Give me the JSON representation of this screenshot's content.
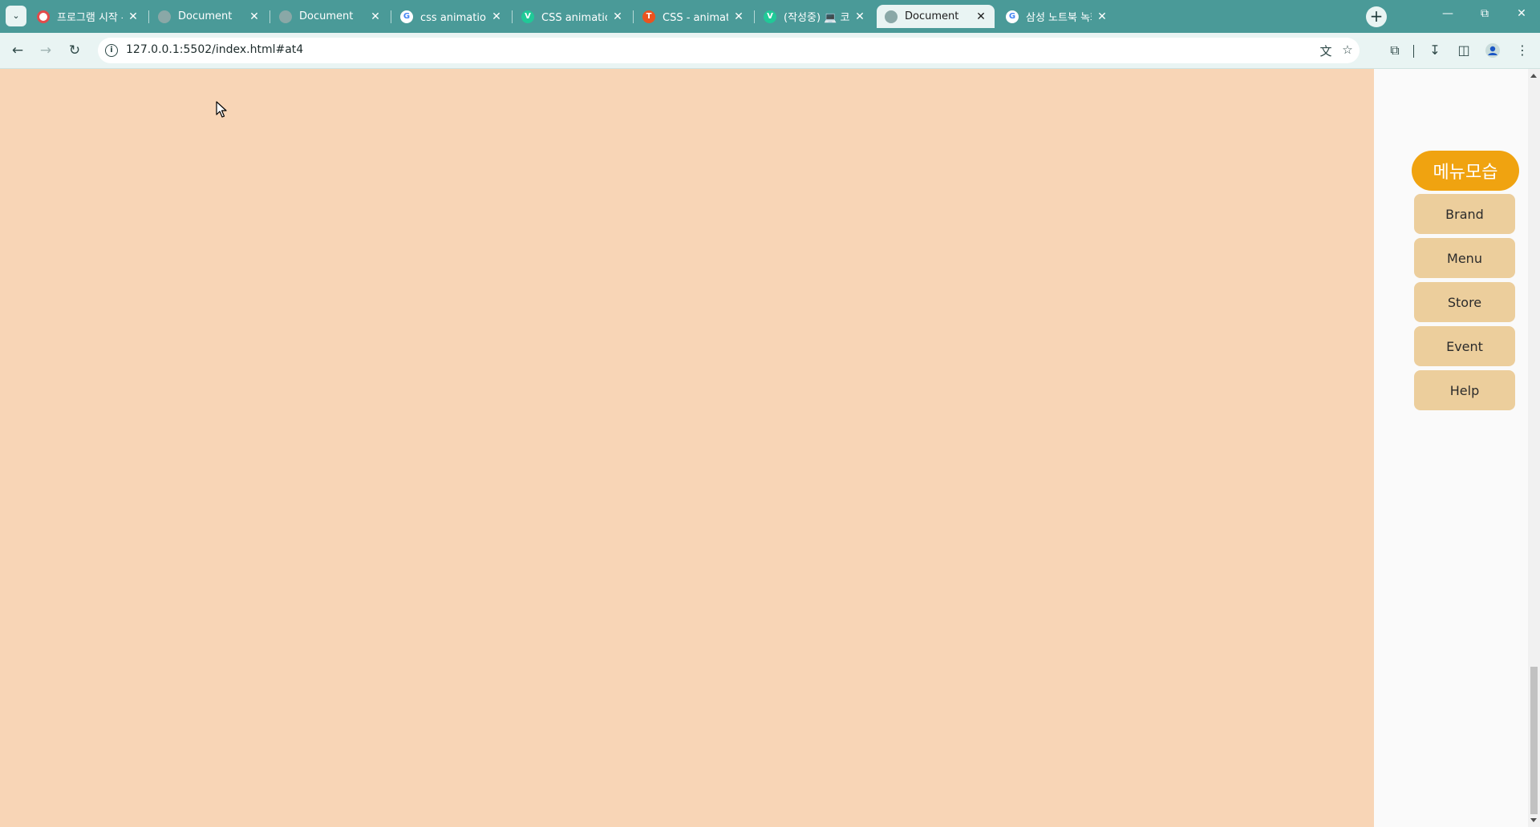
{
  "browser": {
    "tabs": [
      {
        "title": "프로그램 시작 - Dau",
        "favicon": "daum-icon",
        "active": false
      },
      {
        "title": "Document",
        "favicon": "globe-icon",
        "active": false
      },
      {
        "title": "Document",
        "favicon": "globe-icon",
        "active": false
      },
      {
        "title": "css animation 반복",
        "favicon": "google-icon",
        "active": false
      },
      {
        "title": "CSS animation 정리",
        "favicon": "velog-icon",
        "active": false
      },
      {
        "title": "CSS - animation에서",
        "favicon": "tistory-icon",
        "active": false
      },
      {
        "title": "(작성중) 💻 코딩 일",
        "favicon": "velog-icon",
        "active": false
      },
      {
        "title": "Document",
        "favicon": "globe-icon",
        "active": true
      },
      {
        "title": "삼성 노트북 녹화 단",
        "favicon": "google-icon",
        "active": false
      }
    ],
    "new_tab_label": "+",
    "url": "127.0.0.1:5502/index.html#at4",
    "colors": {
      "tabstrip": "#4a9a98",
      "toolbar": "#e9f4f3"
    }
  },
  "page": {
    "background": "#f8d5b6",
    "menu": {
      "header": "메뉴모습",
      "header_color": "#f0a310",
      "item_color": "#ecce9c",
      "items": [
        "Brand",
        "Menu",
        "Store",
        "Event",
        "Help"
      ]
    }
  }
}
